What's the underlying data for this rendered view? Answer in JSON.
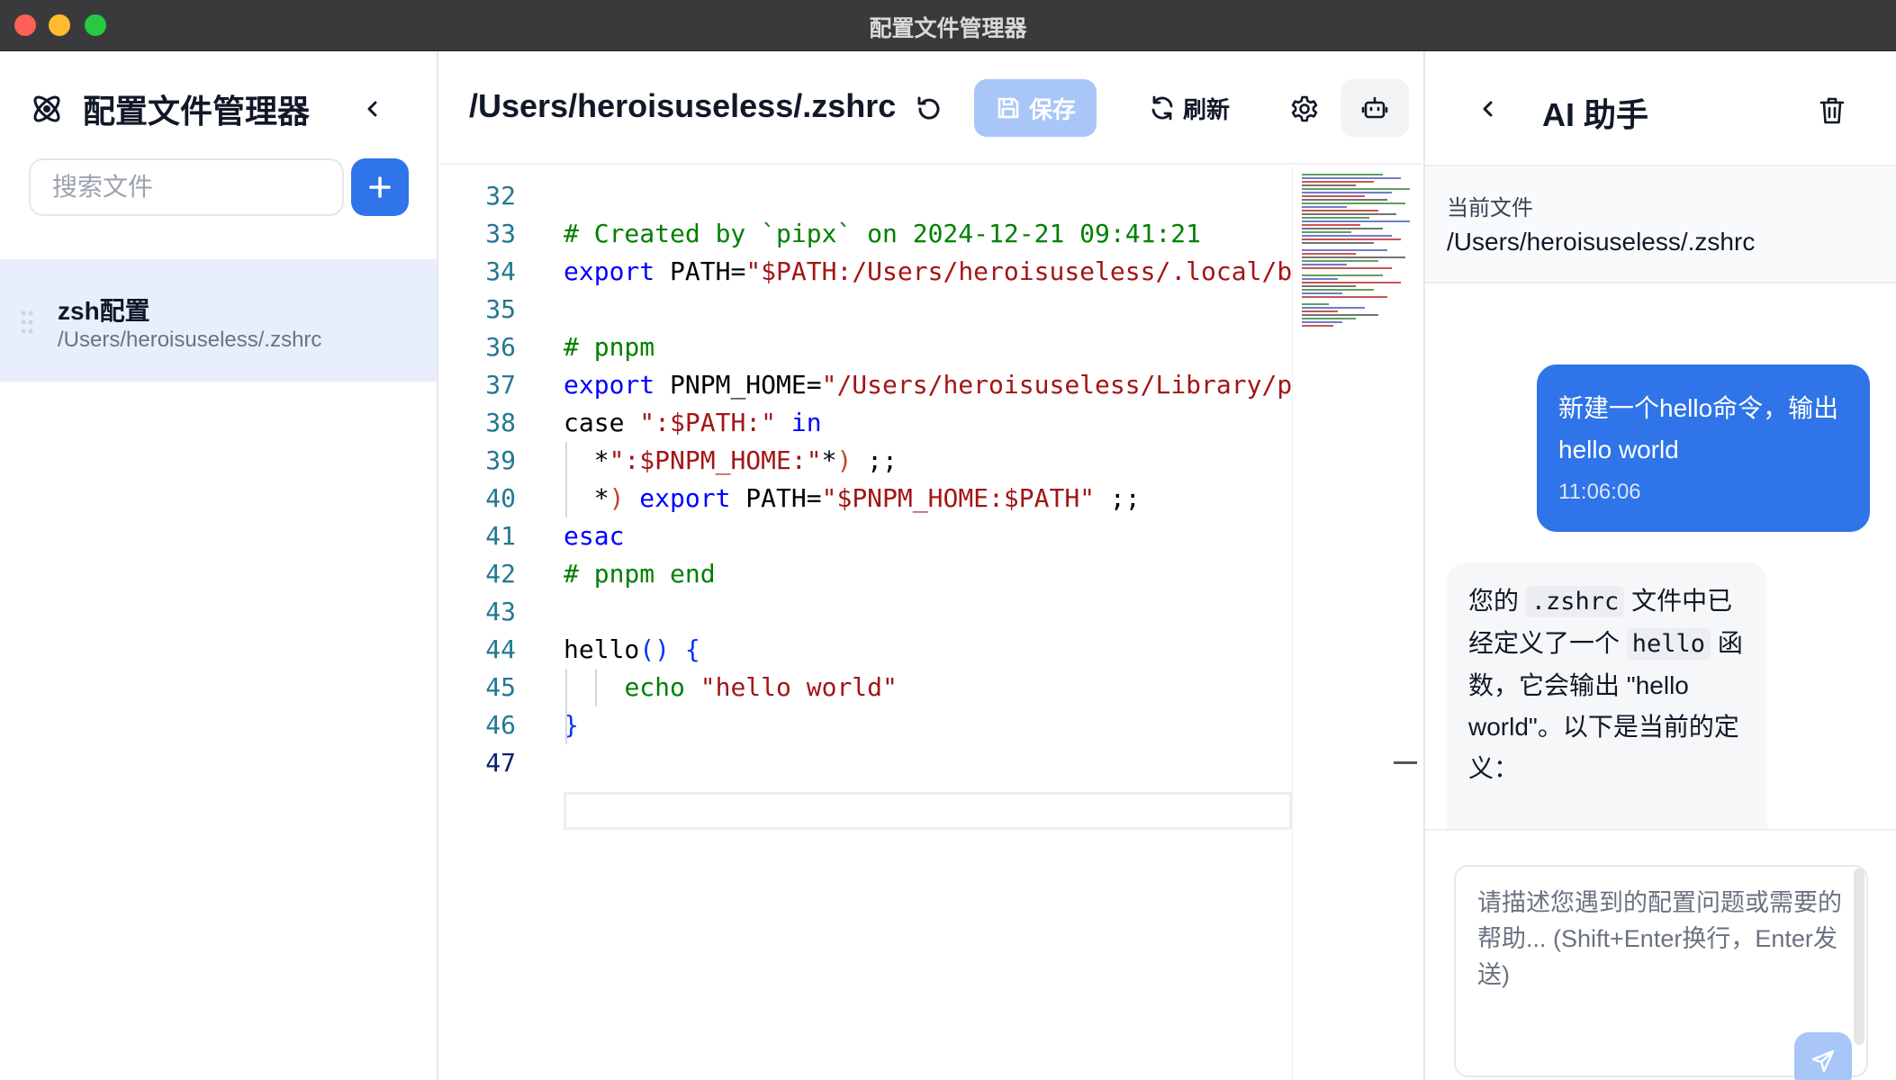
{
  "window": {
    "title": "配置文件管理器"
  },
  "sidebar": {
    "brand_title": "配置文件管理器",
    "search_placeholder": "搜索文件",
    "files": [
      {
        "name": "zsh配置",
        "path": "/Users/heroisuseless/.zshrc"
      }
    ]
  },
  "editor": {
    "file_path": "/Users/heroisuseless/.zshrc",
    "save_label": "保存",
    "refresh_label": "刷新",
    "active_line": 47,
    "lines": [
      {
        "n": "32",
        "parts": []
      },
      {
        "n": "33",
        "parts": [
          {
            "t": "# Created by `pipx` on 2024-12-21 09:41:21",
            "c": "cm"
          }
        ]
      },
      {
        "n": "34",
        "parts": [
          {
            "t": "export",
            "c": "kw"
          },
          {
            "t": " PATH=",
            "c": "pun"
          },
          {
            "t": "\"$PATH:/Users/heroisuseless/.local/b",
            "c": "str"
          }
        ]
      },
      {
        "n": "35",
        "parts": []
      },
      {
        "n": "36",
        "parts": [
          {
            "t": "# pnpm",
            "c": "cm"
          }
        ]
      },
      {
        "n": "37",
        "parts": [
          {
            "t": "export",
            "c": "kw"
          },
          {
            "t": " PNPM_HOME=",
            "c": "pun"
          },
          {
            "t": "\"/Users/heroisuseless/Library/p",
            "c": "str"
          }
        ]
      },
      {
        "n": "38",
        "parts": [
          {
            "t": "case",
            "c": "pun"
          },
          {
            "t": " ",
            "c": "pun"
          },
          {
            "t": "\":$PATH:\"",
            "c": "str"
          },
          {
            "t": " ",
            "c": "pun"
          },
          {
            "t": "in",
            "c": "kw"
          }
        ]
      },
      {
        "n": "39",
        "parts": [
          {
            "t": "  *",
            "c": "pun"
          },
          {
            "t": "\":$PNPM_HOME:\"",
            "c": "str"
          },
          {
            "t": "*",
            "c": "pun"
          },
          {
            "t": ")",
            "c": "par"
          },
          {
            "t": " ;;",
            "c": "pun"
          }
        ]
      },
      {
        "n": "40",
        "parts": [
          {
            "t": "  *",
            "c": "pun"
          },
          {
            "t": ")",
            "c": "par"
          },
          {
            "t": " ",
            "c": "pun"
          },
          {
            "t": "export",
            "c": "kw"
          },
          {
            "t": " PATH=",
            "c": "pun"
          },
          {
            "t": "\"$PNPM_HOME:$PATH\"",
            "c": "str"
          },
          {
            "t": " ;;",
            "c": "pun"
          }
        ]
      },
      {
        "n": "41",
        "parts": [
          {
            "t": "esac",
            "c": "kw"
          }
        ]
      },
      {
        "n": "42",
        "parts": [
          {
            "t": "# pnpm end",
            "c": "cm"
          }
        ]
      },
      {
        "n": "43",
        "parts": []
      },
      {
        "n": "44",
        "parts": [
          {
            "t": "hello",
            "c": "pun"
          },
          {
            "t": "()",
            "c": "br"
          },
          {
            "t": " ",
            "c": "pun"
          },
          {
            "t": "{",
            "c": "br"
          }
        ]
      },
      {
        "n": "45",
        "parts": [
          {
            "t": "    ",
            "c": "pun"
          },
          {
            "t": "echo",
            "c": "cm"
          },
          {
            "t": " ",
            "c": "pun"
          },
          {
            "t": "\"hello world\"",
            "c": "str"
          }
        ]
      },
      {
        "n": "46",
        "parts": [
          {
            "t": "}",
            "c": "br"
          }
        ]
      },
      {
        "n": "47",
        "parts": []
      }
    ]
  },
  "ai": {
    "title": "AI 助手",
    "current_file_label": "当前文件",
    "current_file_path": "/Users/heroisuseless/.zshrc",
    "user_message": "新建一个hello命令，输出hello world",
    "user_time": "11:06:06",
    "bot_prefix": "您的 ",
    "bot_code1": ".zshrc",
    "bot_mid": " 文件中已经定义了一个 ",
    "bot_code2": "hello",
    "bot_suffix": " 函数，它会输出 \"hello world\"。以下是当前的定义：",
    "input_placeholder": "请描述您遇到的配置问题或需要的帮助... (Shift+Enter换行，Enter发送)"
  },
  "colors": {
    "accent": "#2f74e8",
    "accent_light": "#a8c6f7",
    "selected_item": "#e8eefc"
  },
  "icons": {
    "brand": "atom-icon",
    "collapse": "chevron-left-icon",
    "add": "plus-icon",
    "undo": "undo-icon",
    "save": "floppy-icon",
    "refresh": "refresh-icon",
    "settings": "gear-icon",
    "robot": "robot-icon",
    "back": "chevron-left-icon",
    "trash": "trash-icon",
    "send": "paper-plane-icon"
  }
}
